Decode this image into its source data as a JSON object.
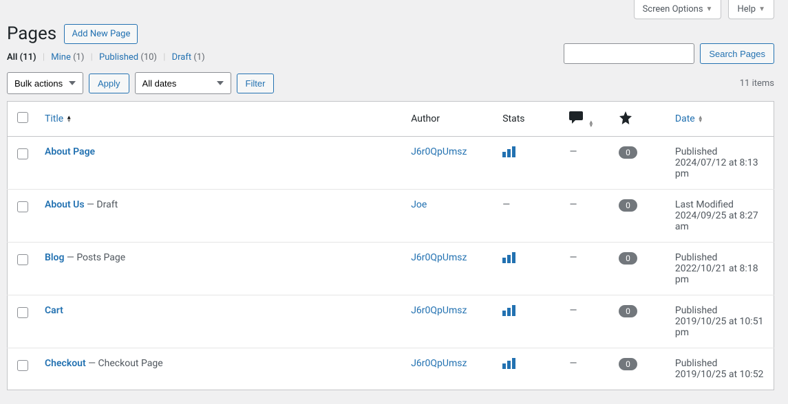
{
  "top_tabs": {
    "screen_options": "Screen Options",
    "help": "Help"
  },
  "header": {
    "title": "Pages",
    "add_new": "Add New Page"
  },
  "filters_row": {
    "all_label": "All",
    "all_count": "(11)",
    "mine_label": "Mine",
    "mine_count": "(1)",
    "published_label": "Published",
    "published_count": "(10)",
    "draft_label": "Draft",
    "draft_count": "(1)"
  },
  "search": {
    "button": "Search Pages",
    "placeholder": ""
  },
  "bulk": {
    "bulk_option": "Bulk actions",
    "apply": "Apply",
    "dates_option": "All dates",
    "filter": "Filter"
  },
  "count_text": "11 items",
  "columns": {
    "title": "Title",
    "author": "Author",
    "stats": "Stats",
    "date": "Date"
  },
  "rows": [
    {
      "title": "About Page",
      "state": null,
      "author": "J6r0QpUmsz",
      "stats": "bars",
      "comments": "—",
      "featured": "0",
      "date_status": "Published",
      "date_when": "2024/07/12 at 8:13 pm"
    },
    {
      "title": "About Us",
      "state": "Draft",
      "author": "Joe",
      "stats": "—",
      "comments": "—",
      "featured": "0",
      "date_status": "Last Modified",
      "date_when": "2024/09/25 at 8:27 am"
    },
    {
      "title": "Blog",
      "state": "Posts Page",
      "author": "J6r0QpUmsz",
      "stats": "bars",
      "comments": "—",
      "featured": "0",
      "date_status": "Published",
      "date_when": "2022/10/21 at 8:18 pm"
    },
    {
      "title": "Cart",
      "state": null,
      "author": "J6r0QpUmsz",
      "stats": "bars",
      "comments": "—",
      "featured": "0",
      "date_status": "Published",
      "date_when": "2019/10/25 at 10:51 pm"
    },
    {
      "title": "Checkout",
      "state": "Checkout Page",
      "author": "J6r0QpUmsz",
      "stats": "bars",
      "comments": "—",
      "featured": "0",
      "date_status": "Published",
      "date_when": "2019/10/25 at 10:52"
    }
  ]
}
